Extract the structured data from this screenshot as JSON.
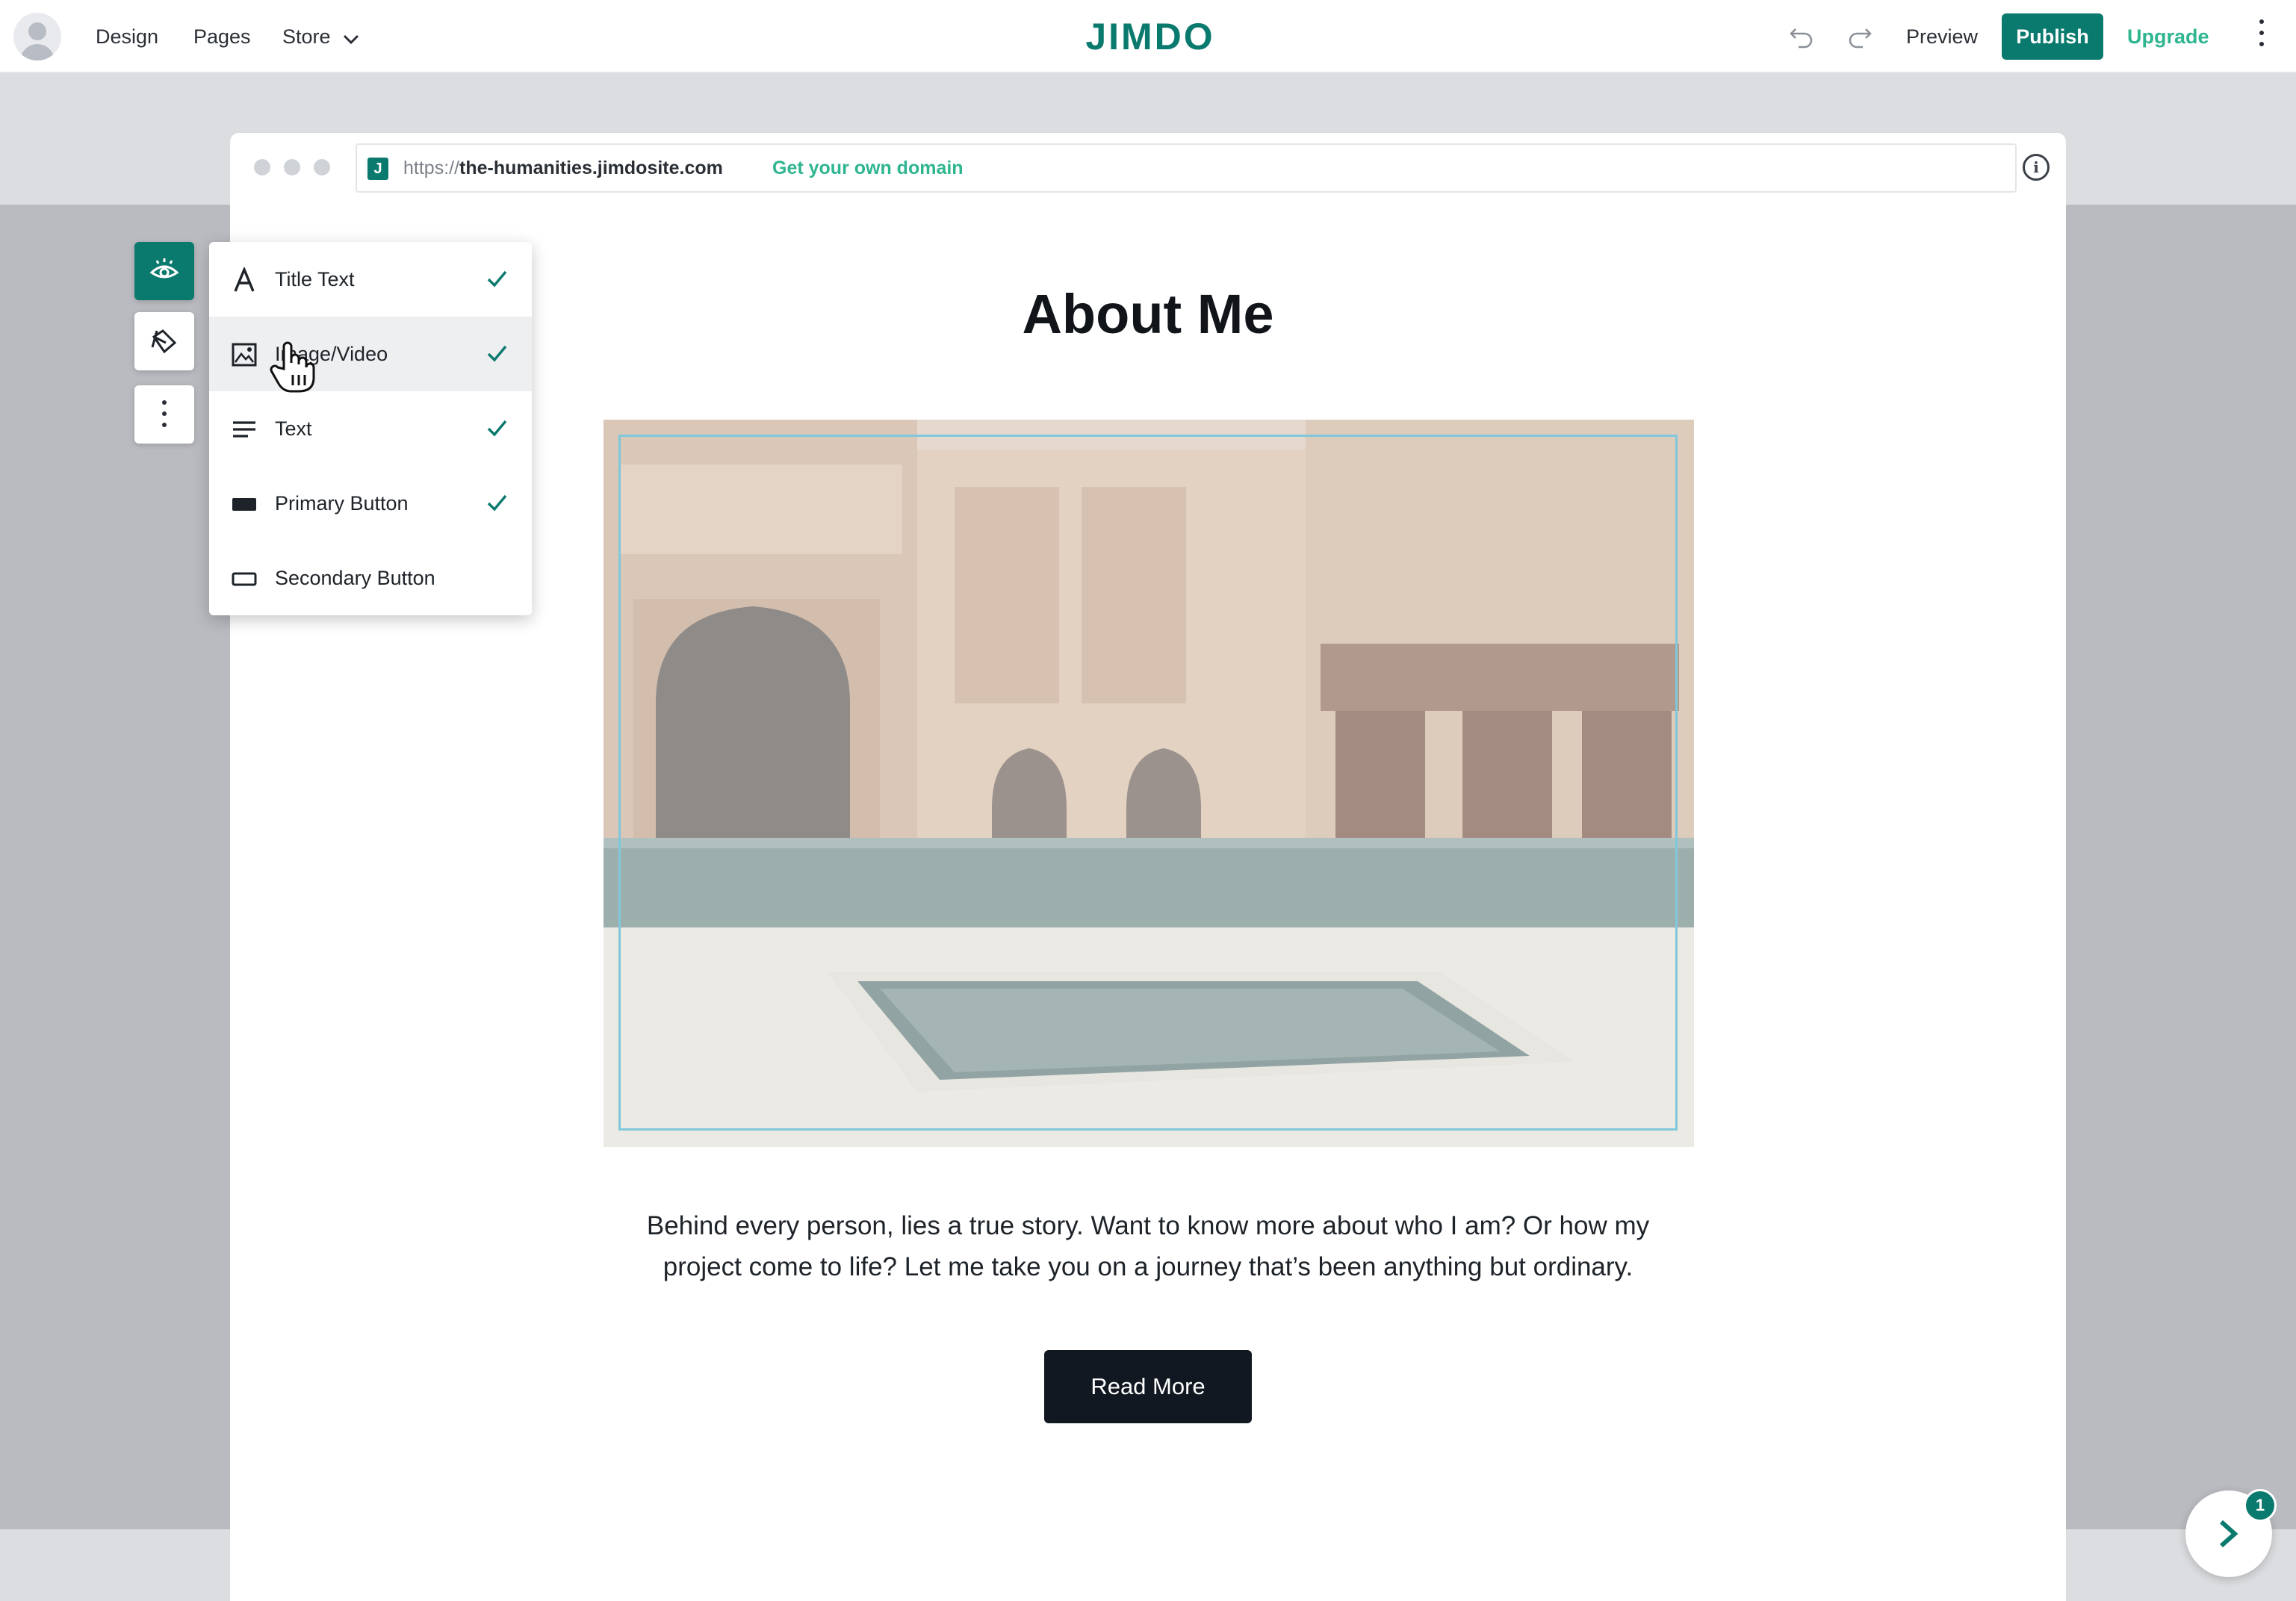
{
  "topbar": {
    "nav": [
      {
        "label": "Design"
      },
      {
        "label": "Pages"
      },
      {
        "label": "Store",
        "has_dropdown": true
      }
    ],
    "logo": "JIMDO",
    "preview_label": "Preview",
    "publish_label": "Publish",
    "upgrade_label": "Upgrade"
  },
  "browser": {
    "url_protocol": "https://",
    "url_host": "the-humanities.jimdosite.com",
    "domain_link": "Get your own domain",
    "favicon_letter": "J",
    "info_glyph": "i"
  },
  "page": {
    "title": "About Me",
    "body": "Behind every person, lies a true story. Want to know more about who I am? Or how my project come to life? Let me take you on a journey that’s been anything but ordinary.",
    "button_label": "Read More"
  },
  "visibility_menu": {
    "items": [
      {
        "label": "Title Text",
        "icon": "title-text-icon",
        "checked": true
      },
      {
        "label": "Image/Video",
        "icon": "image-icon",
        "checked": true,
        "hovered": true
      },
      {
        "label": "Text",
        "icon": "text-lines-icon",
        "checked": true
      },
      {
        "label": "Primary Button",
        "icon": "primary-button-icon",
        "checked": true
      },
      {
        "label": "Secondary Button",
        "icon": "secondary-button-icon",
        "checked": false
      }
    ]
  },
  "fab": {
    "badge": "1"
  },
  "colors": {
    "brand": "#0b7a6e",
    "accent_green": "#2fb590",
    "button_dark": "#111821"
  }
}
